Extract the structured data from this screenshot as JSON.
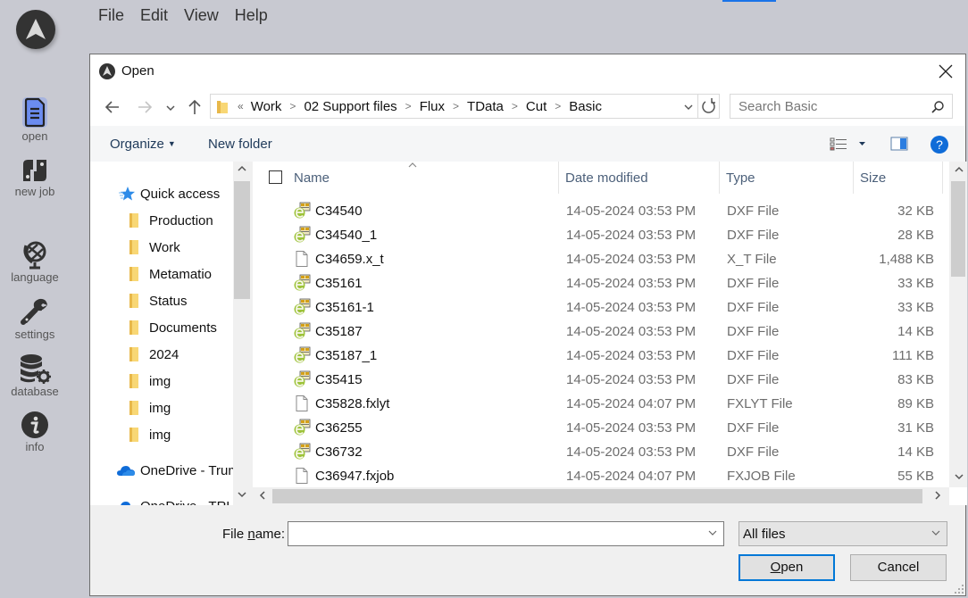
{
  "app": {
    "menu": [
      "File",
      "Edit",
      "View",
      "Help"
    ],
    "sidebar": [
      {
        "label": "open",
        "icon": "document-icon",
        "active": true
      },
      {
        "label": "new job",
        "icon": "new-job-icon"
      },
      {
        "label": "language",
        "icon": "globe-icon"
      },
      {
        "label": "settings",
        "icon": "wrench-icon"
      },
      {
        "label": "database",
        "icon": "database-gear-icon"
      },
      {
        "label": "info",
        "icon": "info-icon"
      }
    ],
    "accent_color": "#1a73e8"
  },
  "dialog": {
    "title": "Open",
    "breadcrumb": [
      "Work",
      "02 Support files",
      "Flux",
      "TData",
      "Cut",
      "Basic"
    ],
    "breadcrumb_overflow": "«",
    "search_placeholder": "Search Basic",
    "toolbar": {
      "organize": "Organize",
      "new_folder": "New folder"
    },
    "nav_pane": {
      "quick_access": "Quick access",
      "items": [
        {
          "label": "Production",
          "pinned": true
        },
        {
          "label": "Work",
          "pinned": true
        },
        {
          "label": "Metamatio",
          "pinned": true
        },
        {
          "label": "Status",
          "pinned": true
        },
        {
          "label": "Documents",
          "pinned": true
        },
        {
          "label": "2024",
          "pinned": false
        },
        {
          "label": "img",
          "pinned": false
        },
        {
          "label": "img",
          "pinned": false
        },
        {
          "label": "img",
          "pinned": false
        }
      ],
      "onedrive": [
        "OneDrive - Trum",
        "OneDrive - TRU"
      ]
    },
    "columns": {
      "name": "Name",
      "date": "Date modified",
      "type": "Type",
      "size": "Size"
    },
    "files": [
      {
        "name": "C34540",
        "date": "14-05-2024 03:53 PM",
        "type": "DXF File",
        "size": "32 KB",
        "icon": "dxf"
      },
      {
        "name": "C34540_1",
        "date": "14-05-2024 03:53 PM",
        "type": "DXF File",
        "size": "28 KB",
        "icon": "dxf"
      },
      {
        "name": "C34659.x_t",
        "date": "14-05-2024 03:53 PM",
        "type": "X_T File",
        "size": "1,488 KB",
        "icon": "generic"
      },
      {
        "name": "C35161",
        "date": "14-05-2024 03:53 PM",
        "type": "DXF File",
        "size": "33 KB",
        "icon": "dxf"
      },
      {
        "name": "C35161-1",
        "date": "14-05-2024 03:53 PM",
        "type": "DXF File",
        "size": "33 KB",
        "icon": "dxf"
      },
      {
        "name": "C35187",
        "date": "14-05-2024 03:53 PM",
        "type": "DXF File",
        "size": "14 KB",
        "icon": "dxf"
      },
      {
        "name": "C35187_1",
        "date": "14-05-2024 03:53 PM",
        "type": "DXF File",
        "size": "111 KB",
        "icon": "dxf"
      },
      {
        "name": "C35415",
        "date": "14-05-2024 03:53 PM",
        "type": "DXF File",
        "size": "83 KB",
        "icon": "dxf"
      },
      {
        "name": "C35828.fxlyt",
        "date": "14-05-2024 04:07 PM",
        "type": "FXLYT File",
        "size": "89 KB",
        "icon": "generic"
      },
      {
        "name": "C36255",
        "date": "14-05-2024 03:53 PM",
        "type": "DXF File",
        "size": "31 KB",
        "icon": "dxf"
      },
      {
        "name": "C36732",
        "date": "14-05-2024 03:53 PM",
        "type": "DXF File",
        "size": "14 KB",
        "icon": "dxf"
      },
      {
        "name": "C36947.fxjob",
        "date": "14-05-2024 04:07 PM",
        "type": "FXJOB File",
        "size": "55 KB",
        "icon": "generic"
      }
    ],
    "file_name_label_pre": "File ",
    "file_name_label_u": "n",
    "file_name_label_post": "ame:",
    "file_name_value": "",
    "filter_value": "All files",
    "open_u": "O",
    "open_rest": "pen",
    "cancel": "Cancel"
  }
}
